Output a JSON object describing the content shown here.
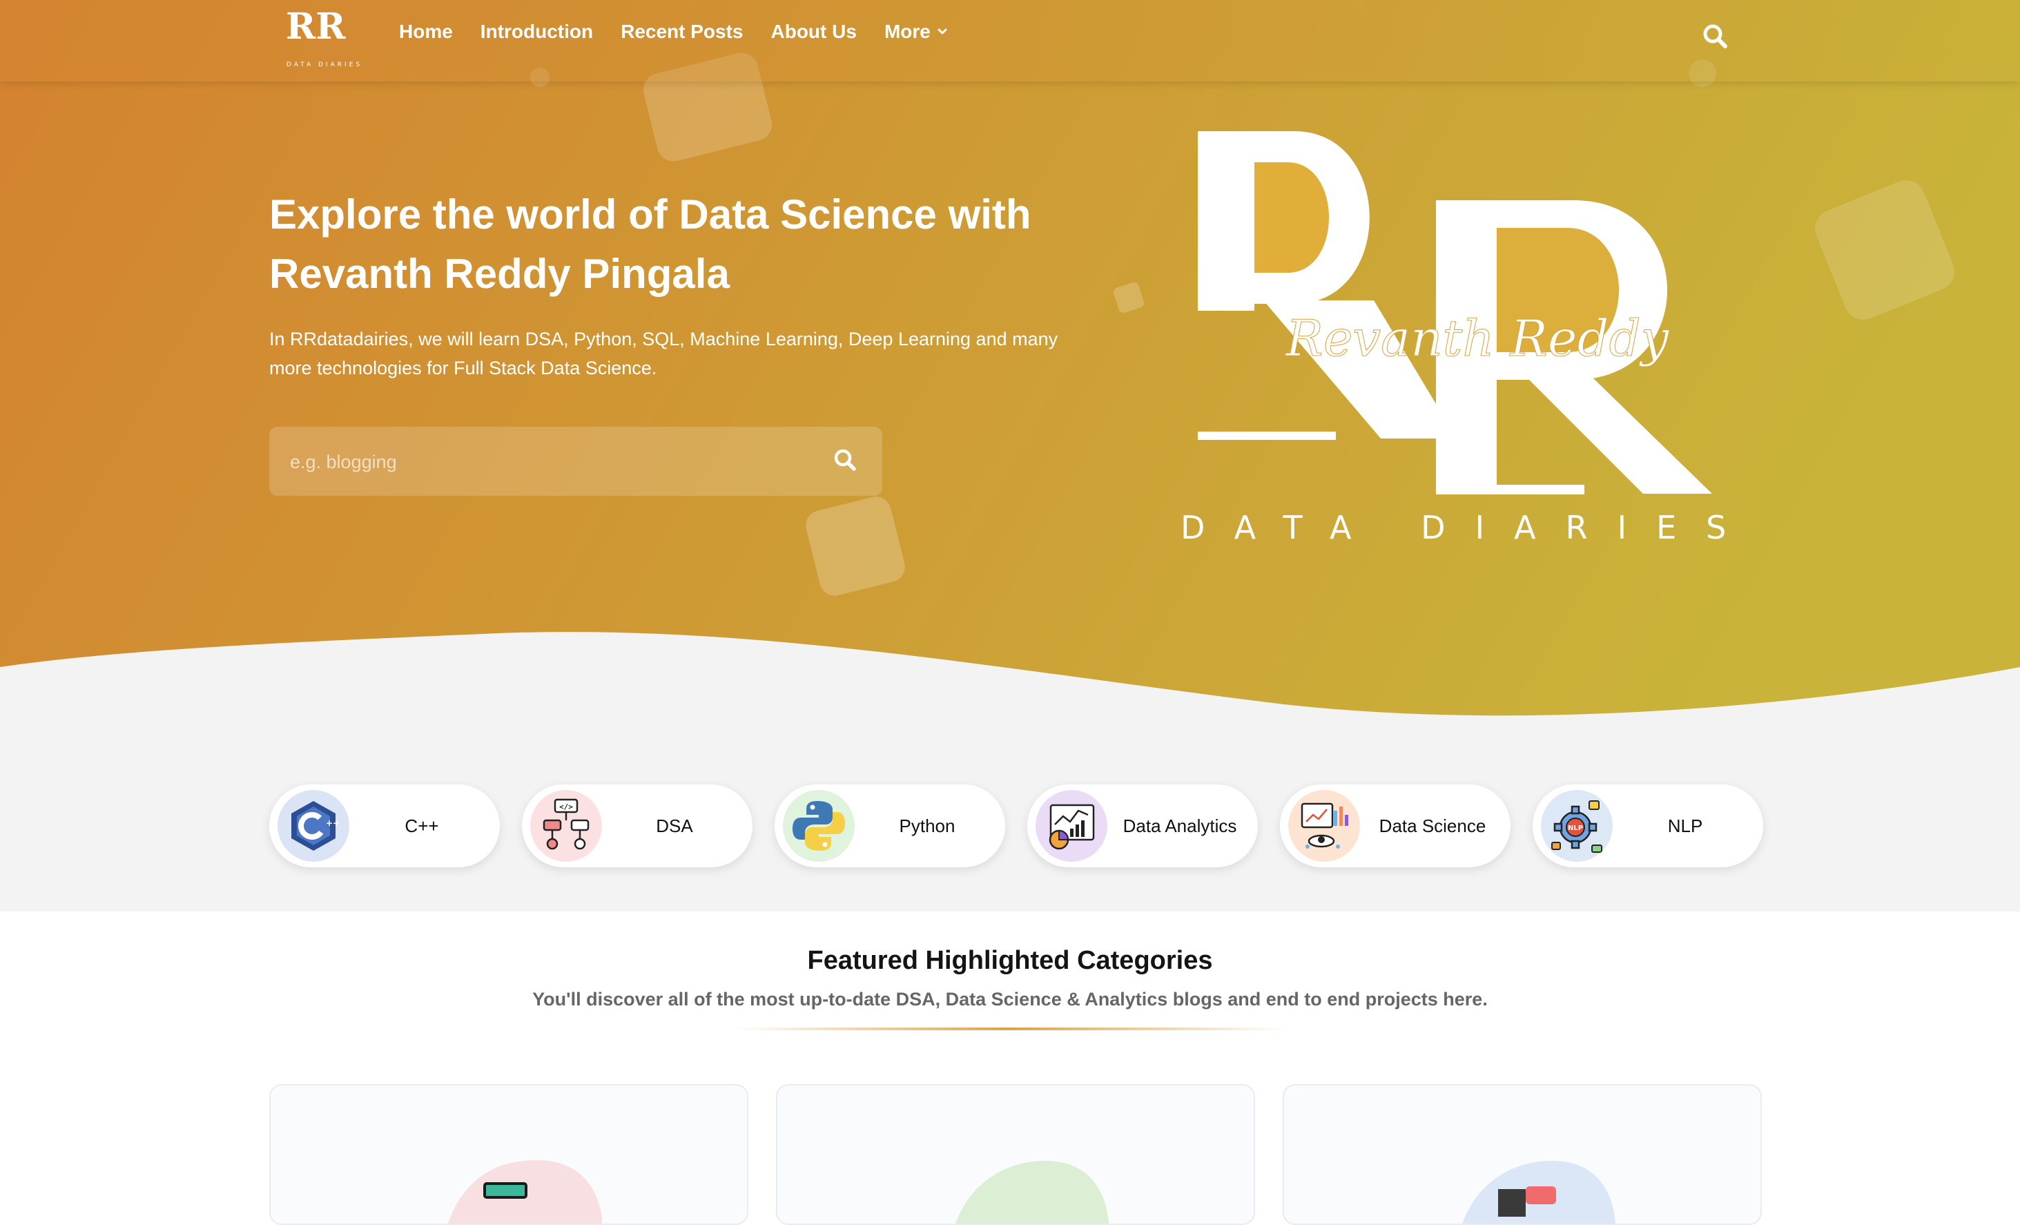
{
  "nav": {
    "items": [
      {
        "label": "Home"
      },
      {
        "label": "Introduction"
      },
      {
        "label": "Recent Posts"
      },
      {
        "label": "About Us"
      },
      {
        "label": "More"
      }
    ]
  },
  "logo": {
    "monogram": "RR",
    "script": "Revanth Reddy",
    "tagline": "DATA DIARIES"
  },
  "hero": {
    "title_line1": "Explore the world of Data Science with",
    "title_line2": "Revanth Reddy Pingala",
    "subtitle_line1": "In RRdatadairies, we will learn DSA, Python, SQL, Machine Learning, Deep Learning and many",
    "subtitle_line2": "more technologies for Full Stack Data Science.",
    "search_placeholder": "e.g. blogging"
  },
  "categories": [
    {
      "label": "C++",
      "icon": "cpp-icon"
    },
    {
      "label": "DSA",
      "icon": "flowchart-icon"
    },
    {
      "label": "Python",
      "icon": "python-icon"
    },
    {
      "label": "Data Analytics",
      "icon": "analytics-chart-icon"
    },
    {
      "label": "Data Science",
      "icon": "data-science-icon"
    },
    {
      "label": "NLP",
      "icon": "nlp-gear-icon"
    }
  ],
  "featured": {
    "title": "Featured Highlighted Categories",
    "subtitle": "You'll discover all of the most up-to-date DSA, Data Science & Analytics blogs and end to end projects here."
  },
  "colors": {
    "hero_gradient_start": "#d4822f",
    "hero_gradient_end": "#c9b33a",
    "page_bg": "#f3f3f3"
  }
}
